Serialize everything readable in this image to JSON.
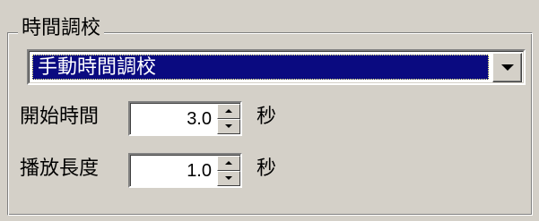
{
  "group": {
    "title": "時間調校"
  },
  "mode_select": {
    "value": "手動時間調校"
  },
  "start_time": {
    "label": "開始時間",
    "value": "3.0",
    "unit": "秒"
  },
  "duration": {
    "label": "播放長度",
    "value": "1.0",
    "unit": "秒"
  },
  "colors": {
    "panel": "#d4d0c8",
    "selection": "#0a0a80",
    "field": "#ffffff"
  },
  "icons": {
    "combo_arrow": "chevron-down-icon",
    "spin_up": "spin-up-icon",
    "spin_down": "spin-down-icon"
  }
}
